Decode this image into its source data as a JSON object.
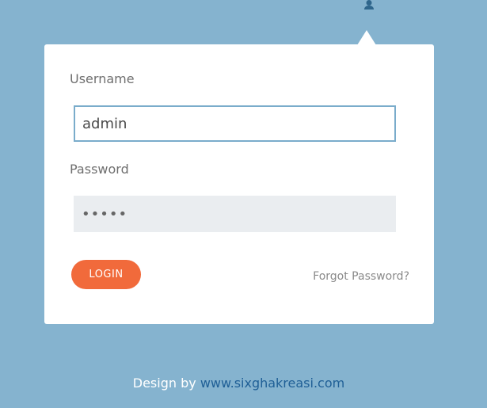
{
  "login_form": {
    "username_label": "Username",
    "username_value": "admin",
    "password_label": "Password",
    "password_value": "•••••",
    "login_button_label": "LOGIN",
    "forgot_password_text": "Forgot Password?"
  },
  "footer": {
    "credit_text": "Design by",
    "credit_link_text": "www.sixghakreasi.com"
  },
  "icons": {
    "user": "user-icon"
  },
  "colors": {
    "background": "#85b3cf",
    "card": "#ffffff",
    "login_button": "#f16a3b",
    "input_border": "#7aaccb",
    "password_background": "#eaedf0",
    "footer_link": "#1f5f96"
  }
}
